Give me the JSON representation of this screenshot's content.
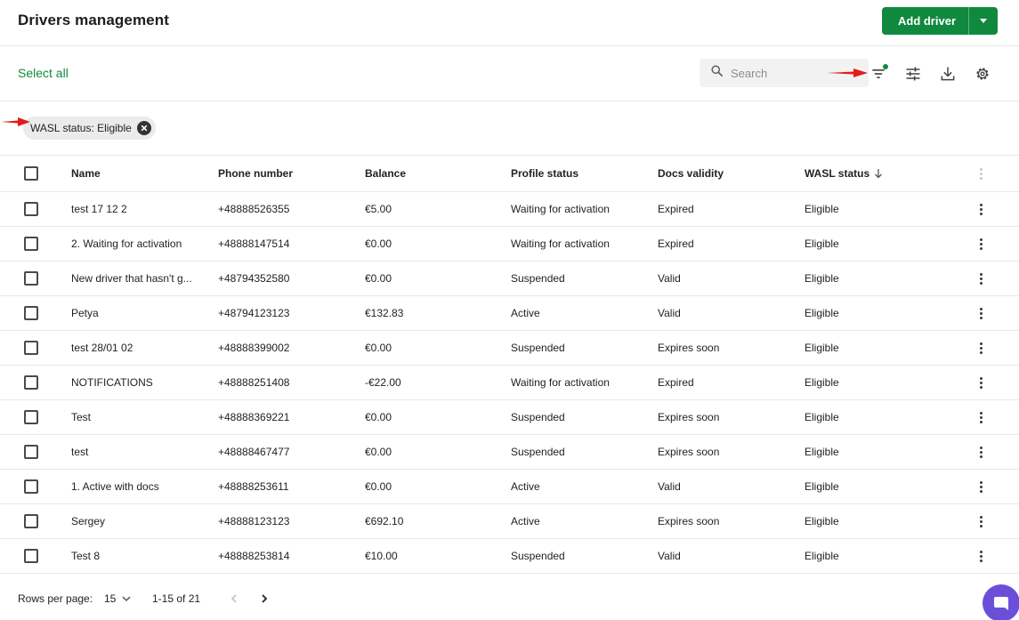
{
  "header": {
    "title": "Drivers management",
    "add_label": "Add driver"
  },
  "toolbar": {
    "select_all": "Select all",
    "search_placeholder": "Search",
    "filter_active_color": "#10893e"
  },
  "filters": {
    "chip_label": "WASL status: Eligible"
  },
  "table": {
    "columns": {
      "name": "Name",
      "phone": "Phone number",
      "balance": "Balance",
      "profile": "Profile status",
      "docs": "Docs validity",
      "wasl": "WASL status"
    },
    "rows": [
      {
        "name": "test 17 12 2",
        "phone": "+48888526355",
        "balance": "€5.00",
        "profile": "Waiting for activation",
        "docs": "Expired",
        "wasl": "Eligible"
      },
      {
        "name": "2. Waiting for activation",
        "phone": "+48888147514",
        "balance": "€0.00",
        "profile": "Waiting for activation",
        "docs": "Expired",
        "wasl": "Eligible"
      },
      {
        "name": "New driver that hasn't g...",
        "phone": "+48794352580",
        "balance": "€0.00",
        "profile": "Suspended",
        "docs": "Valid",
        "wasl": "Eligible"
      },
      {
        "name": "Petya",
        "phone": "+48794123123",
        "balance": "€132.83",
        "profile": "Active",
        "docs": "Valid",
        "wasl": "Eligible"
      },
      {
        "name": "test 28/01 02",
        "phone": "+48888399002",
        "balance": "€0.00",
        "profile": "Suspended",
        "docs": "Expires soon",
        "wasl": "Eligible"
      },
      {
        "name": "NOTIFICATIONS",
        "phone": "+48888251408",
        "balance": "-€22.00",
        "profile": "Waiting for activation",
        "docs": "Expired",
        "wasl": "Eligible"
      },
      {
        "name": "Test",
        "phone": "+48888369221",
        "balance": "€0.00",
        "profile": "Suspended",
        "docs": "Expires soon",
        "wasl": "Eligible"
      },
      {
        "name": "test",
        "phone": "+48888467477",
        "balance": "€0.00",
        "profile": "Suspended",
        "docs": "Expires soon",
        "wasl": "Eligible"
      },
      {
        "name": "1. Active with docs",
        "phone": "+48888253611",
        "balance": "€0.00",
        "profile": "Active",
        "docs": "Valid",
        "wasl": "Eligible"
      },
      {
        "name": "Sergey",
        "phone": "+48888123123",
        "balance": "€692.10",
        "profile": "Active",
        "docs": "Expires soon",
        "wasl": "Eligible"
      },
      {
        "name": "Test 8",
        "phone": "+48888253814",
        "balance": "€10.00",
        "profile": "Suspended",
        "docs": "Valid",
        "wasl": "Eligible"
      }
    ]
  },
  "pagination": {
    "rows_per_page_label": "Rows per page:",
    "rows_per_page": "15",
    "range": "1-15 of 21"
  },
  "colors": {
    "brand": "#10893e",
    "annotation_arrow": "#e31b1b",
    "chat": "#6c4fd8"
  },
  "icons": [
    "search-icon",
    "filter-icon",
    "columns-adjust-icon",
    "download-icon",
    "gear-icon",
    "close-icon",
    "kebab-menu-icon",
    "sort-down-icon",
    "chevron-down-icon",
    "chevron-left-icon",
    "chevron-right-icon",
    "chat-icon"
  ]
}
